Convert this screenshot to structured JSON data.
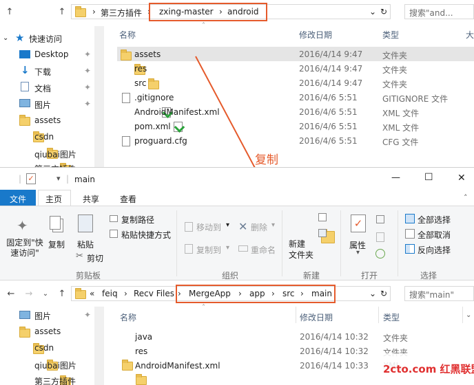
{
  "top": {
    "address": [
      "第三方插件",
      "zxing-master",
      "android"
    ],
    "search_placeholder": "搜索\"and...",
    "columns": {
      "name": "名称",
      "modified": "修改日期",
      "type": "类型",
      "size": "大"
    },
    "nav": [
      {
        "label": "快速访问",
        "icon": "star-icon"
      },
      {
        "label": "Desktop",
        "icon": "desktop-icon"
      },
      {
        "label": "下载",
        "icon": "download-icon"
      },
      {
        "label": "文档",
        "icon": "document-icon"
      },
      {
        "label": "图片",
        "icon": "picture-icon"
      },
      {
        "label": "assets",
        "icon": "folder-icon"
      },
      {
        "label": "csdn",
        "icon": "folder-icon"
      },
      {
        "label": "qiubai图片",
        "icon": "folder-icon"
      },
      {
        "label": "第三方插件",
        "icon": "folder-icon"
      }
    ],
    "files": [
      {
        "name": "assets",
        "date": "2016/4/14 9:47",
        "type": "文件夹",
        "icon": "folder"
      },
      {
        "name": "res",
        "date": "2016/4/14 9:47",
        "type": "文件夹",
        "icon": "folder"
      },
      {
        "name": "src",
        "date": "2016/4/14 9:47",
        "type": "文件夹",
        "icon": "folder"
      },
      {
        "name": ".gitignore",
        "date": "2016/4/6 5:51",
        "type": "GITIGNORE 文件",
        "icon": "file"
      },
      {
        "name": "AndroidManifest.xml",
        "date": "2016/4/6 5:51",
        "type": "XML 文件",
        "icon": "xml"
      },
      {
        "name": "pom.xml",
        "date": "2016/4/6 5:51",
        "type": "XML 文件",
        "icon": "xml"
      },
      {
        "name": "proguard.cfg",
        "date": "2016/4/6 5:51",
        "type": "CFG 文件",
        "icon": "file"
      }
    ]
  },
  "annotation": "复制",
  "window": {
    "title": "main",
    "controls": {
      "minimize": "—",
      "maximize": "☐",
      "close": "✕"
    }
  },
  "ribbon": {
    "tabs": [
      "文件",
      "主页",
      "共享",
      "查看"
    ],
    "clipboard": {
      "pin": "固定到\"快速访问\"",
      "copy": "复制",
      "paste": "粘贴",
      "copy_path": "复制路径",
      "paste_shortcut": "粘贴快捷方式",
      "cut": "剪切",
      "group": "剪贴板"
    },
    "organize": {
      "move_to": "移动到",
      "copy_to": "复制到",
      "delete": "删除",
      "rename": "重命名",
      "group": "组织"
    },
    "new": {
      "new_folder": "新建\n文件夹",
      "group": "新建"
    },
    "open": {
      "properties": "属性",
      "group": "打开"
    },
    "select": {
      "select_all": "全部选择",
      "select_none": "全部取消",
      "invert": "反向选择",
      "group": "选择"
    }
  },
  "bottom": {
    "address_prefix": "«",
    "address": [
      "feiq",
      "Recv Files",
      "MergeApp",
      "app",
      "src",
      "main"
    ],
    "search_placeholder": "搜索\"main\"",
    "columns": {
      "name": "名称",
      "modified": "修改日期",
      "type": "类型"
    },
    "nav": [
      "图片",
      "assets",
      "csdn",
      "qiubai图片",
      "第三方插件"
    ],
    "files": [
      {
        "name": "java",
        "date": "2016/4/14 10:32",
        "type": "文件夹",
        "icon": "folder"
      },
      {
        "name": "res",
        "date": "2016/4/14 10:32",
        "type": "文件夹",
        "icon": "folder"
      },
      {
        "name": "AndroidManifest.xml",
        "date": "2016/4/14 10:33",
        "type": "XML",
        "icon": "xml"
      }
    ]
  },
  "watermark": "2cto.com 红黑联盟",
  "colors": {
    "accent": "#1979ca",
    "annotation": "#e55a2b",
    "selected_row": "#e5e5e5"
  }
}
